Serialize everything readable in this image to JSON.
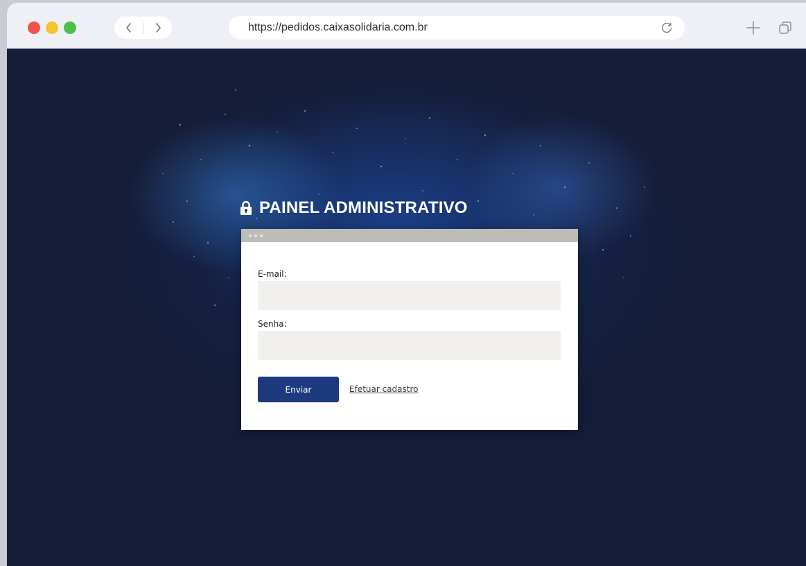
{
  "browser": {
    "url": "https://pedidos.caixasolidaria.com.br",
    "icons": {
      "back": "chevron-left-icon",
      "forward": "chevron-right-icon",
      "reload": "reload-icon",
      "new_tab": "plus-icon",
      "tabs": "tabs-overview-icon"
    },
    "traffic_lights": {
      "close": "#ee5249",
      "minimize": "#f5c431",
      "zoom": "#4cbf4b"
    }
  },
  "page": {
    "heading": "PAINEL ADMINISTRATIVO",
    "heading_icon": "lock-icon",
    "form": {
      "email_label": "E-mail:",
      "email_value": "",
      "password_label": "Senha:",
      "password_value": "",
      "submit_label": "Enviar",
      "signup_link": "Efetuar cadastro"
    },
    "colors": {
      "background": "#151d38",
      "button": "#1d3a7f",
      "input_bg": "#f1f0ed",
      "card_bar": "#bdbcb7"
    }
  }
}
